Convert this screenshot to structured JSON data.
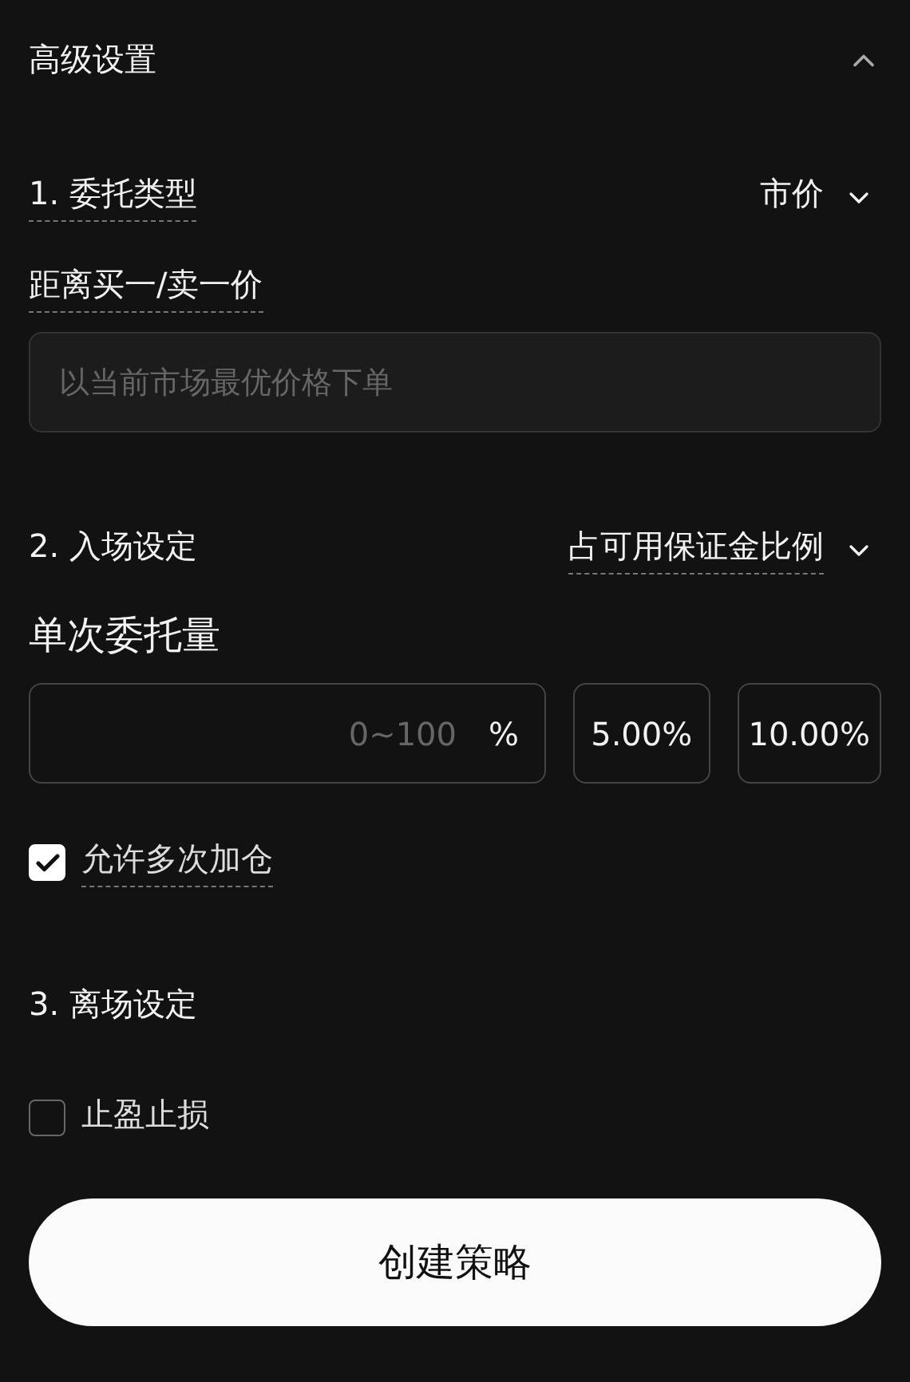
{
  "panel": {
    "title": "高级设置",
    "expanded": true
  },
  "order_type": {
    "label": "1. 委托类型",
    "value": "市价"
  },
  "price_offset": {
    "label": "距离买一/卖一价",
    "placeholder": "以当前市场最优价格下单"
  },
  "entry": {
    "label": "2. 入场设定",
    "mode": "占可用保证金比例",
    "amount_label": "单次委托量",
    "amount": {
      "placeholder": "0~100",
      "unit": "%"
    },
    "presets": [
      {
        "label": "5.00%",
        "selected": false
      },
      {
        "label": "10.00%",
        "selected": false
      }
    ],
    "allow_add": {
      "label": "允许多次加仓",
      "checked": true
    }
  },
  "exit": {
    "label": "3. 离场设定",
    "take_profit_stop_loss": {
      "label": "止盈止损",
      "checked": false
    }
  },
  "submit": "创建策略"
}
